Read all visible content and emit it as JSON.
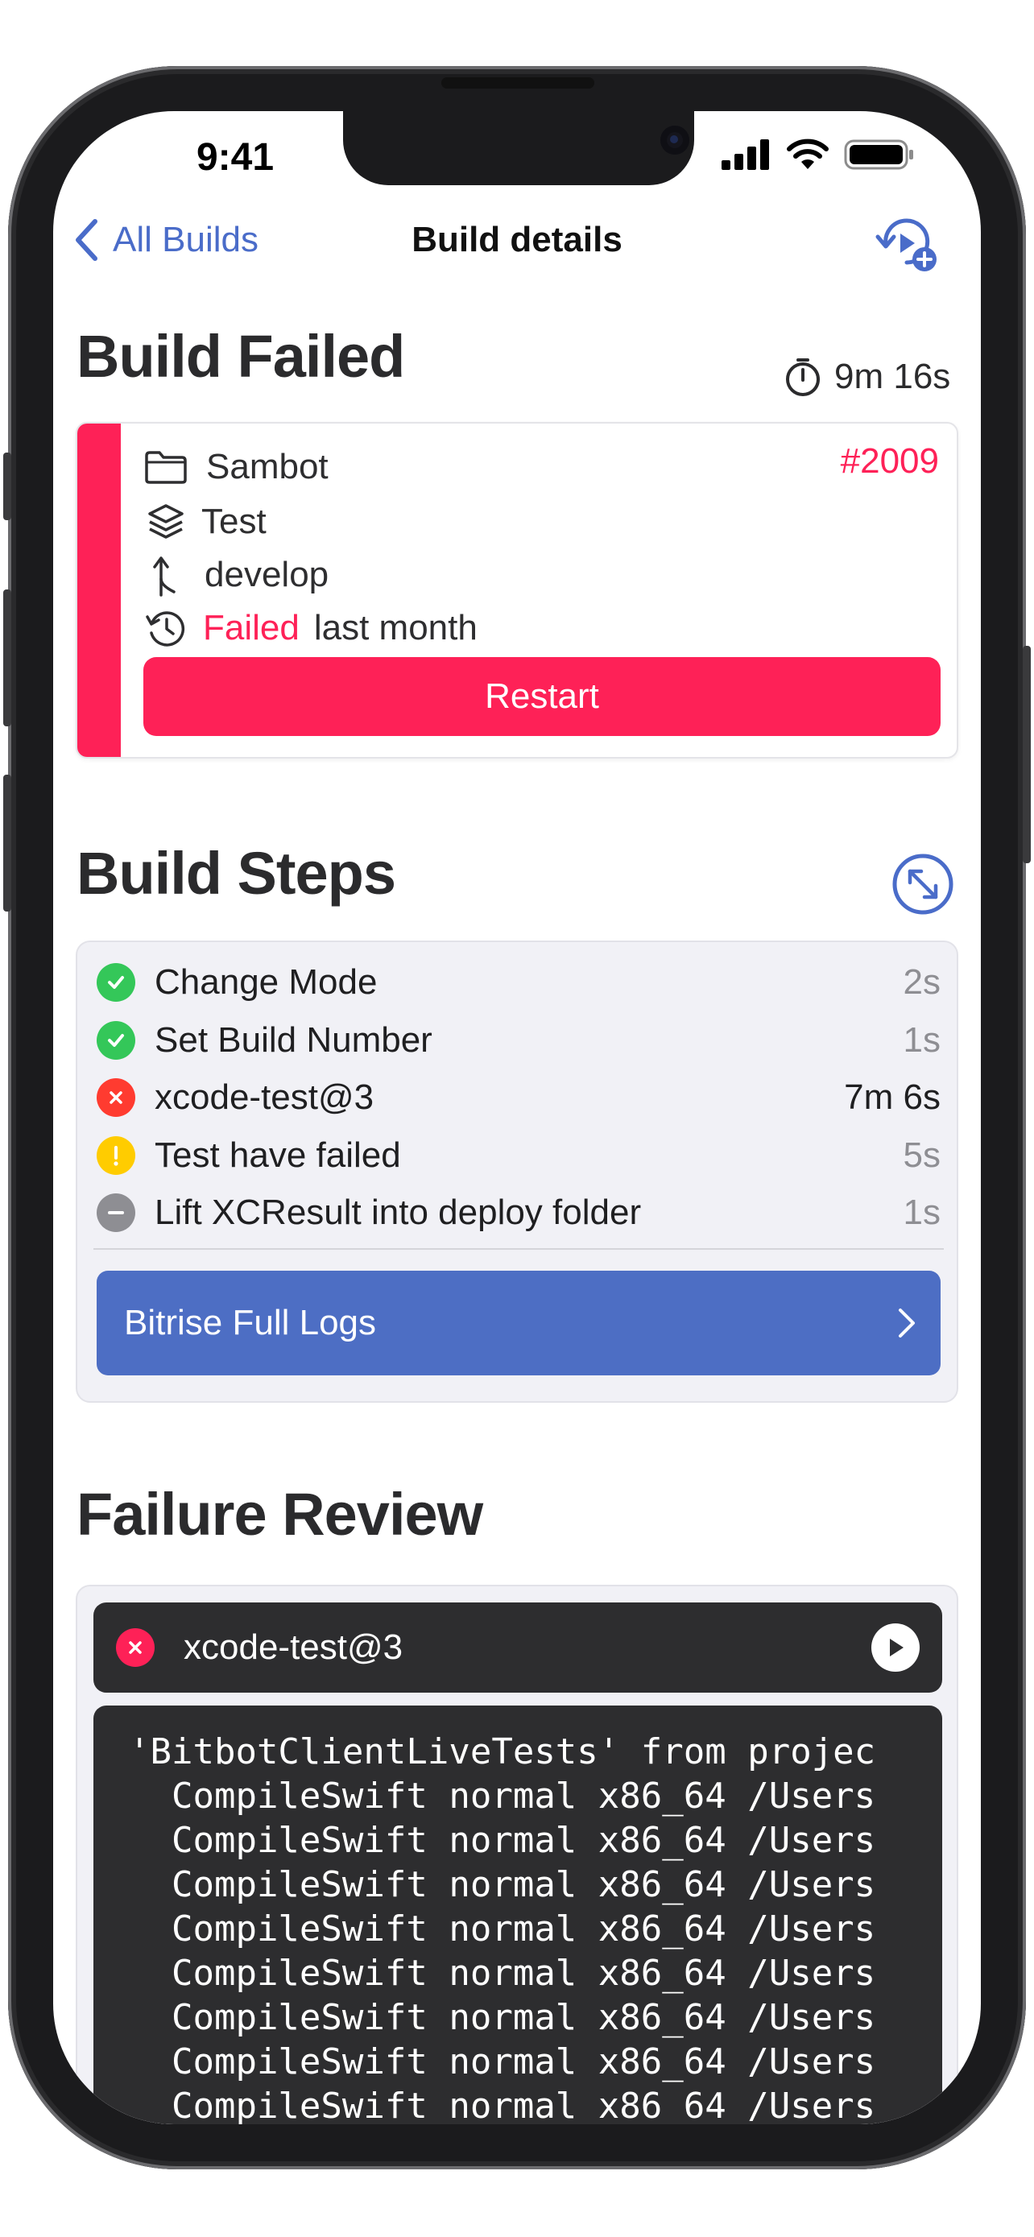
{
  "status_bar": {
    "time": "9:41"
  },
  "nav": {
    "back_label": "All Builds",
    "title": "Build details",
    "action_icon": "restart-schedule-icon"
  },
  "header": {
    "title": "Build Failed",
    "duration": "9m 16s"
  },
  "summary": {
    "app": "Sambot",
    "build_number": "#2009",
    "workflow": "Test",
    "branch": "develop",
    "status": "Failed",
    "relative_time": "last month",
    "restart_label": "Restart",
    "accent": "#fe2157"
  },
  "steps": {
    "title": "Build Steps",
    "items": [
      {
        "name": "Change Mode",
        "time": "2s",
        "status": "success"
      },
      {
        "name": "Set Build Number",
        "time": "1s",
        "status": "success"
      },
      {
        "name": "xcode-test@3",
        "time": "7m 6s",
        "status": "failed"
      },
      {
        "name": "Test have failed",
        "time": "5s",
        "status": "warning"
      },
      {
        "name": "Lift XCResult into deploy folder",
        "time": "1s",
        "status": "skipped"
      }
    ],
    "logs_button": "Bitrise Full Logs"
  },
  "review": {
    "title": "Failure Review",
    "step_name": "xcode-test@3",
    "log_lines": [
      "'BitbotClientLiveTests' from projec",
      "  CompileSwift normal x86_64 /Users",
      "  CompileSwift normal x86_64 /Users",
      "  CompileSwift normal x86_64 /Users",
      "  CompileSwift normal x86_64 /Users",
      "  CompileSwift normal x86_64 /Users",
      "  CompileSwift normal x86_64 /Users",
      "  CompileSwift normal x86_64 /Users",
      "  CompileSwift normal x86_64 /Users"
    ]
  },
  "colors": {
    "success": "#34c759",
    "failed": "#ff3b30",
    "warning": "#ffcc00",
    "skipped": "#8e8e93",
    "link": "#4a6cc9",
    "logs_button": "#4d6ec4"
  }
}
